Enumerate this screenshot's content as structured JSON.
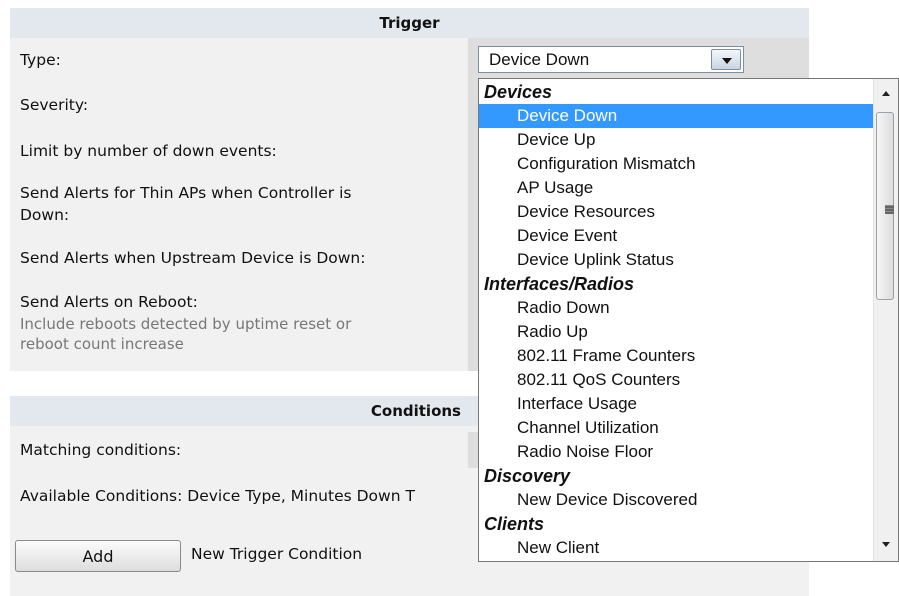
{
  "trigger": {
    "title": "Trigger",
    "labels": {
      "type": "Type:",
      "severity": "Severity:",
      "limit": "Limit by number of down events:",
      "thin_aps_line1": "Send Alerts for Thin APs when Controller is",
      "thin_aps_line2": "Down:",
      "upstream": "Send Alerts when Upstream Device is Down:",
      "reboot": "Send Alerts on Reboot:",
      "reboot_sub1": "Include reboots detected by uptime reset or",
      "reboot_sub2": "reboot count increase"
    },
    "type_select": {
      "value": "Device Down",
      "groups": [
        {
          "label": "Devices",
          "options": [
            "Device Down",
            "Device Up",
            "Configuration Mismatch",
            "AP Usage",
            "Device Resources",
            "Device Event",
            "Device Uplink Status"
          ]
        },
        {
          "label": "Interfaces/Radios",
          "options": [
            "Radio Down",
            "Radio Up",
            "802.11 Frame Counters",
            "802.11 QoS Counters",
            "Interface Usage",
            "Channel Utilization",
            "Radio Noise Floor"
          ]
        },
        {
          "label": "Discovery",
          "options": [
            "New Device Discovered"
          ]
        },
        {
          "label": "Clients",
          "options": [
            "New Client"
          ]
        }
      ],
      "highlighted": "Device Down",
      "highlight_color": "#3399ff"
    }
  },
  "conditions": {
    "title": "Conditions",
    "matching_label": "Matching conditions:",
    "available_label": "Available Conditions: Device Type, Minutes Down T",
    "add_button": "Add",
    "new_trigger_label": "New Trigger Condition"
  }
}
